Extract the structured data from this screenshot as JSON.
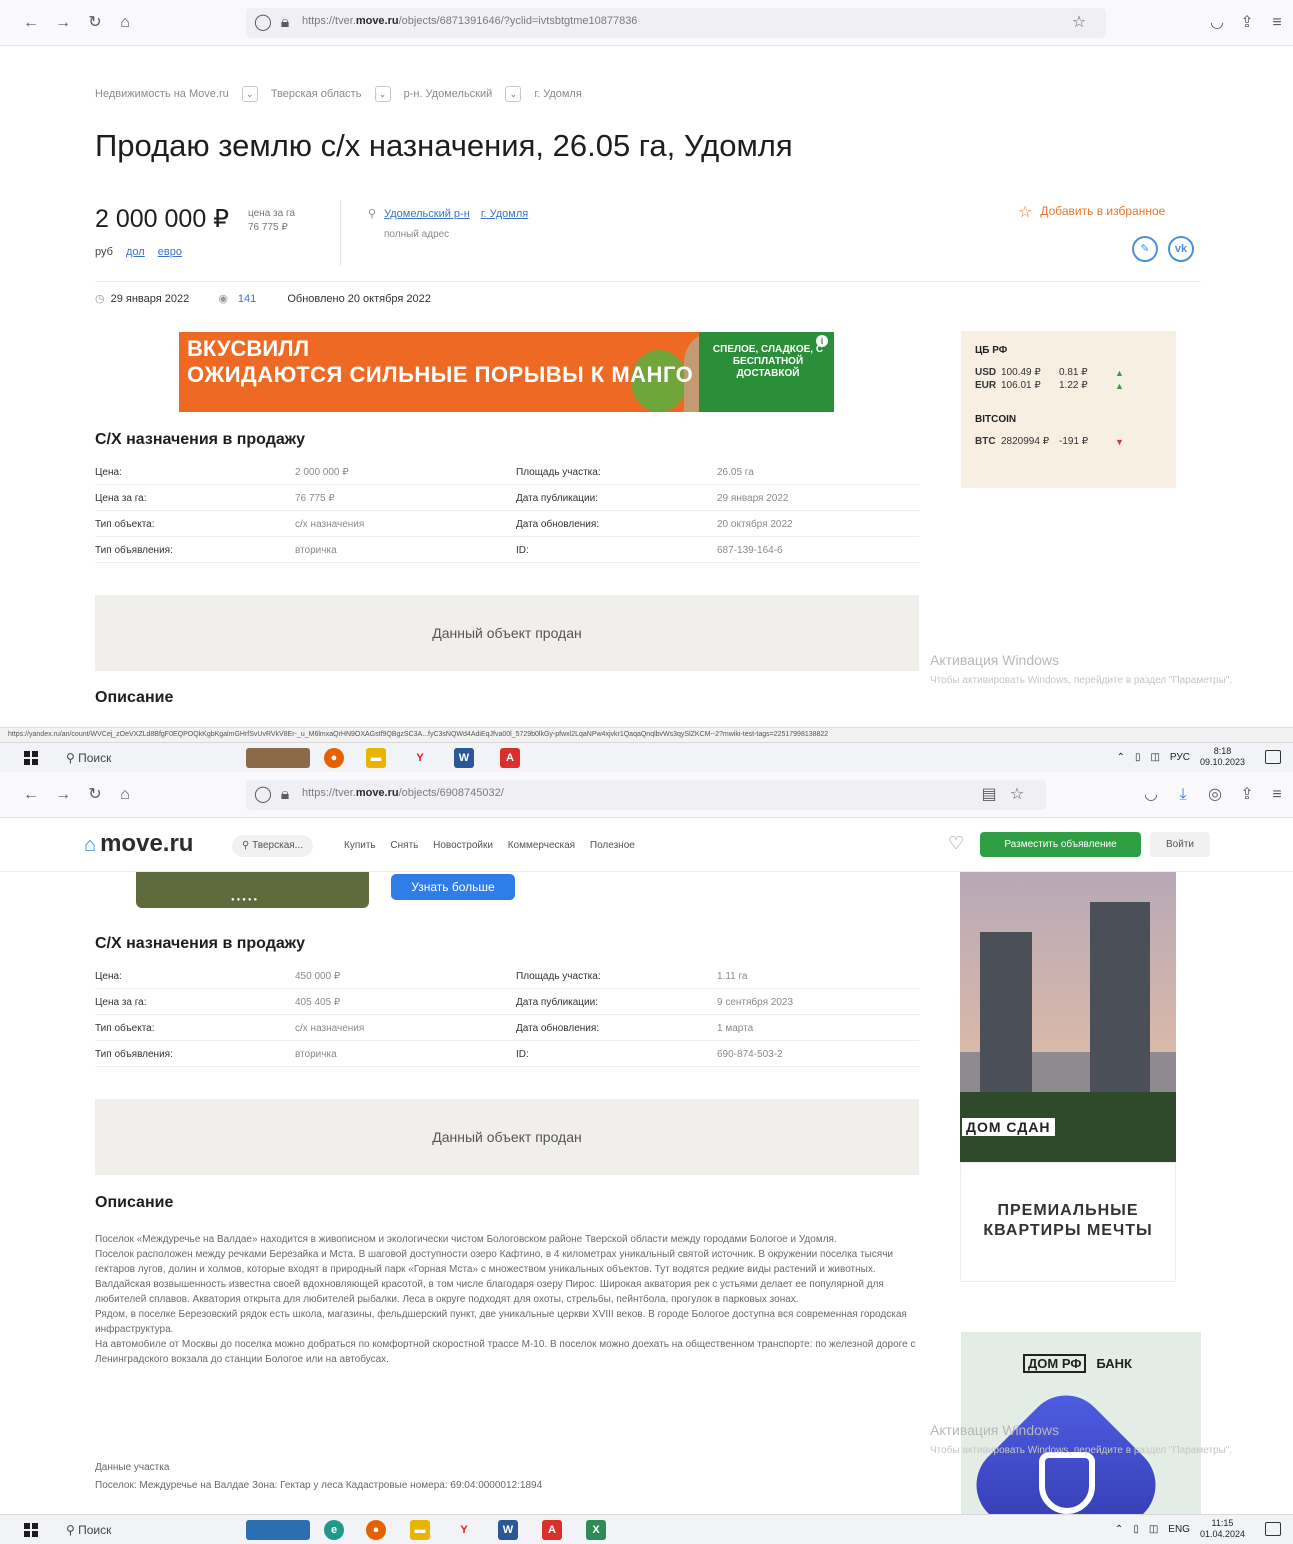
{
  "shot1": {
    "browser": {
      "url_prefix": "https://tver.",
      "url_domain": "move.ru",
      "url_suffix": "/objects/6871391646/?yclid=ivtsbtgtme10877836"
    },
    "breadcrumb": [
      "Недвижимость на Move.ru",
      "Тверская область",
      "р-н. Удомельский",
      "г. Удомля"
    ],
    "title": "Продаю землю с/х назначения, 26.05 га, Удомля",
    "price": "2 000 000 ₽",
    "price_per_label": "цена за га",
    "price_per_value": "76 775 ₽",
    "currencies": {
      "current": "руб",
      "usd": "дол",
      "eur": "евро"
    },
    "address": {
      "district": "Удомельский р-н",
      "city": "г. Удомля",
      "full": "полный адрес"
    },
    "favorite_label": "Добавить в избранное",
    "share": {
      "edit": "✎",
      "vk": "vk"
    },
    "meta": {
      "date": "29 января 2022",
      "views": "141",
      "updated": "Обновлено 20 октября 2022"
    },
    "ad": {
      "brand": "ВКУСВИЛЛ",
      "slogan": "ОЖИДАЮТСЯ СИЛЬНЫЕ ПОРЫВЫ К МАНГО",
      "right_text": "СПЕЛОЕ, СЛАДКОЕ, С БЕСПЛАТНОЙ ДОСТАВКОЙ",
      "info_icon": "i"
    },
    "rates": {
      "cb_title": "ЦБ РФ",
      "rows": [
        {
          "code": "USD",
          "value": "100.49 ₽",
          "change": "0.81 ₽",
          "dir": "▲"
        },
        {
          "code": "EUR",
          "value": "106.01 ₽",
          "change": "1.22 ₽",
          "dir": "▲"
        }
      ],
      "btc_title": "BITCOIN",
      "btc": {
        "code": "BTC",
        "value": "2820994 ₽",
        "change": "-191 ₽",
        "dir": "▼"
      }
    },
    "section_title": "С/Х назначения в продажу",
    "details": [
      [
        "Цена:",
        "2 000 000 ₽",
        "Площадь участка:",
        "26.05 га"
      ],
      [
        "Цена за га:",
        "76 775 ₽",
        "Дата публикации:",
        "29 января 2022"
      ],
      [
        "Тип объекта:",
        "с/х назначения",
        "Дата обновления:",
        "20 октября 2022"
      ],
      [
        "Тип объявления:",
        "вторичка",
        "ID:",
        "687-139-164-6"
      ]
    ],
    "sold_text": "Данный объект продан",
    "activation": {
      "title": "Активация Windows",
      "hint": "Чтобы активировать Windows, перейдите в раздел \"Параметры\"."
    },
    "description_title": "Описание",
    "status_url": "https://yandex.ru/an/count/WVCej_zOeVXZLd8BfgF0EQPOQkKgbKgalmGHrfSvUvRVkV8Er-_u_M6lmxaQrHN9OXAGstf9QBgzSC3A...fyC3sNQWd4AdiEqJfva00l_5729b0lkGy-pfwxl2LqaNPw4xjvkr1QaqaQnqlbvWs3qySlZKCM--2?mwiki-test-tags=22517998138822"
  },
  "taskbar1": {
    "search": "Поиск",
    "lang": "РУС",
    "time": "8:18",
    "date": "09.10.2023"
  },
  "shot2": {
    "browser": {
      "url_prefix": "https://tver.",
      "url_domain": "move.ru",
      "url_suffix": "/objects/6908745032/"
    },
    "logo": "move.ru",
    "region": "Тверская...",
    "nav": [
      "Купить",
      "Снять",
      "Новостройки",
      "Коммерческая",
      "Полезное"
    ],
    "post_button": "Разместить объявление",
    "login_button": "Войти",
    "more_button": "Узнать больше",
    "section_title": "С/Х назначения в продажу",
    "details": [
      [
        "Цена:",
        "450 000 ₽",
        "Площадь участка:",
        "1.11 га"
      ],
      [
        "Цена за га:",
        "405 405 ₽",
        "Дата публикации:",
        "9 сентября 2023"
      ],
      [
        "Тип объекта:",
        "с/х назначения",
        "Дата обновления:",
        "1 марта"
      ],
      [
        "Тип объявления:",
        "вторичка",
        "ID:",
        "690-874-503-2"
      ]
    ],
    "sold_text": "Данный объект продан",
    "description_title": "Описание",
    "description": [
      "Поселок «Междуречье на Валдае» находится в живописном и экологически чистом Бологовском районе Тверской области между городами Бологое и Удомля.",
      "Поселок расположен между речками Березайка и Мста. В шаговой доступности озеро Кафтино, в 4 километрах уникальный святой источник. В окружении поселка тысячи гектаров лугов, долин и холмов, которые входят в природный парк «Горная Мста» с множеством уникальных объектов. Тут водятся редкие виды растений и животных.",
      "Валдайская возвышенность известна своей вдохновляющей красотой, в том числе благодаря озеру Пирос. Широкая акватория рек с устьями делает ее популярной для любителей сплавов. Акватория открыта для любителей рыбалки. Леса в округе подходят для охоты, стрельбы, пейнтбола, прогулок в парковых зонах.",
      "Рядом, в поселке Березовский рядок есть школа, магазины, фельдшерский пункт, две уникальные церкви XVIII веков. В городе Бологое доступна вся современная городская инфраструктура.",
      "На автомобиле от Москвы до поселка можно добраться по комфортной скоростной трассе М-10. В поселок можно доехать на общественном транспорте: по железной дороге с Ленинградского вокзала до станции Бологое или на автобусах."
    ],
    "plot_title": "Данные участка",
    "plot_text": "Поселок: Междуречье на Валдае Зона: Гектар у леса Кадастровые номера: 69:04:0000012:1894",
    "ad_estate": {
      "badge": "ДОМ СДАН",
      "text": "ПРЕМИАЛЬНЫЕ КВАРТИРЫ МЕЧТЫ"
    },
    "ad_bank": {
      "logo_mark": "ДОМ РФ",
      "logo_text": "БАНК"
    },
    "activation": {
      "title": "Активация Windows",
      "hint": "Чтобы активировать Windows, перейдите в раздел \"Параметры\"."
    }
  },
  "taskbar2": {
    "search": "Поиск",
    "lang": "ENG",
    "time": "11:15",
    "date": "01.04.2024"
  },
  "colors": {
    "accent": "#3b73c8",
    "favorite": "#e8762c",
    "post_button": "#2ea043",
    "more_button": "#2f7ee8",
    "sold_bg": "#f1efeb",
    "rates_bg": "#f6efe2"
  }
}
